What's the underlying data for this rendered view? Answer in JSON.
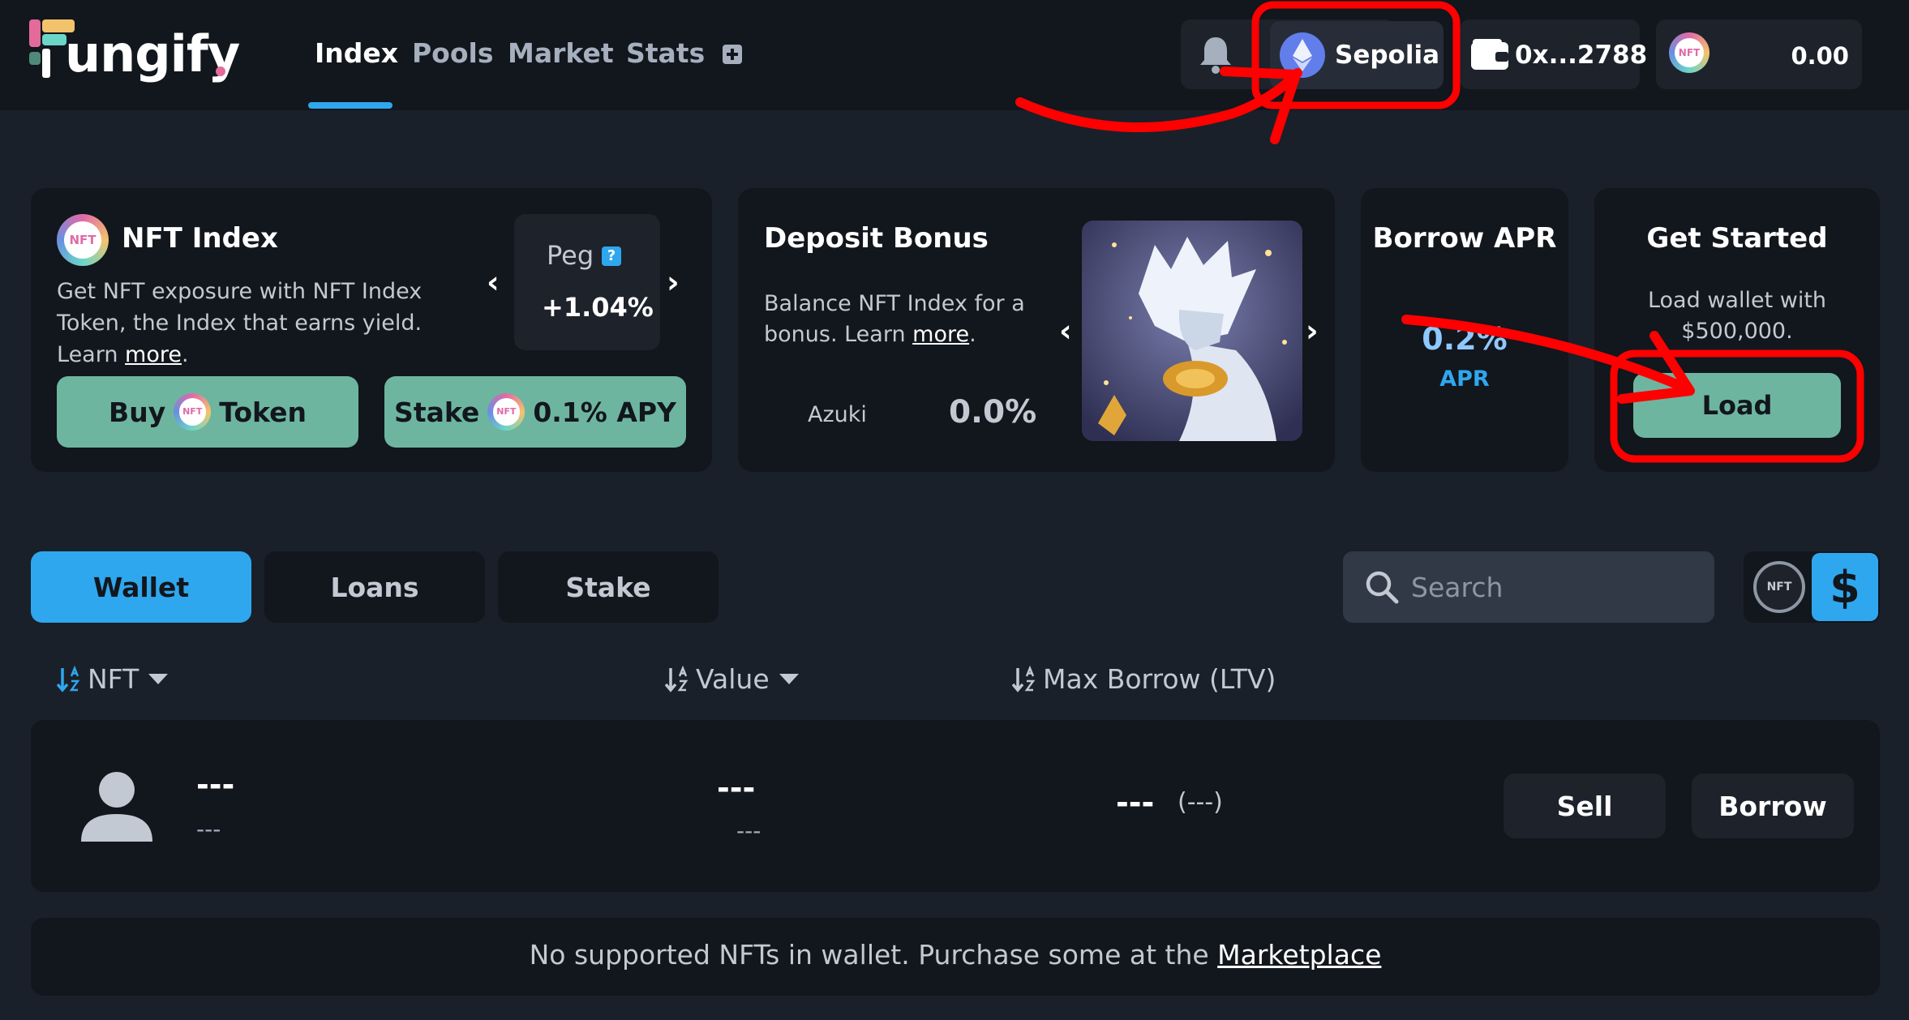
{
  "brand": {
    "logo_text": "ungify"
  },
  "nav": {
    "items": [
      "Index",
      "Pools",
      "Market",
      "Stats"
    ],
    "network": "Sepolia",
    "wallet_address": "0x...2788",
    "balance": "0.00"
  },
  "index_card": {
    "badge": "NFT",
    "title": "NFT Index",
    "desc_prefix": "Get NFT exposure with NFT Index Token, the Index that earns yield. Learn ",
    "desc_link": "more",
    "desc_suffix": ".",
    "peg_label": "Peg",
    "peg_help": "?",
    "peg_value": "+1.04%",
    "prev_glyph": "‹",
    "next_glyph": "›",
    "buy_prefix": "Buy",
    "buy_suffix": "Token",
    "stake_prefix": "Stake",
    "stake_suffix": "0.1% APY"
  },
  "bonus_card": {
    "title": "Deposit Bonus",
    "desc_prefix": "Balance NFT Index for a bonus. Learn ",
    "desc_link": "more",
    "desc_suffix": ".",
    "collection": "Azuki",
    "bonus_pct": "0.0%"
  },
  "apr_card": {
    "title": "Borrow APR",
    "value": "0.2%",
    "label": "APR"
  },
  "start_card": {
    "title": "Get Started",
    "desc": "Load wallet with $500,000.",
    "button": "Load"
  },
  "tabs": [
    "Wallet",
    "Loans",
    "Stake"
  ],
  "search": {
    "placeholder": "Search"
  },
  "currency_toggle": {
    "nft": "NFT",
    "usd": "$"
  },
  "table": {
    "headers": [
      "NFT",
      "Value",
      "Max Borrow (LTV)"
    ],
    "row": {
      "name": "---",
      "sub": "---",
      "value": "---",
      "value_sub": "---",
      "ltv": "---",
      "ltv_sub": "(---)",
      "sell": "Sell",
      "borrow": "Borrow"
    }
  },
  "footer": {
    "text": "No supported NFTs in wallet. Purchase some at the ",
    "link": "Marketplace"
  },
  "colors": {
    "accent": "#2fa7ee",
    "green_button": "#6eb5a0",
    "annotation": "#ff0000"
  }
}
